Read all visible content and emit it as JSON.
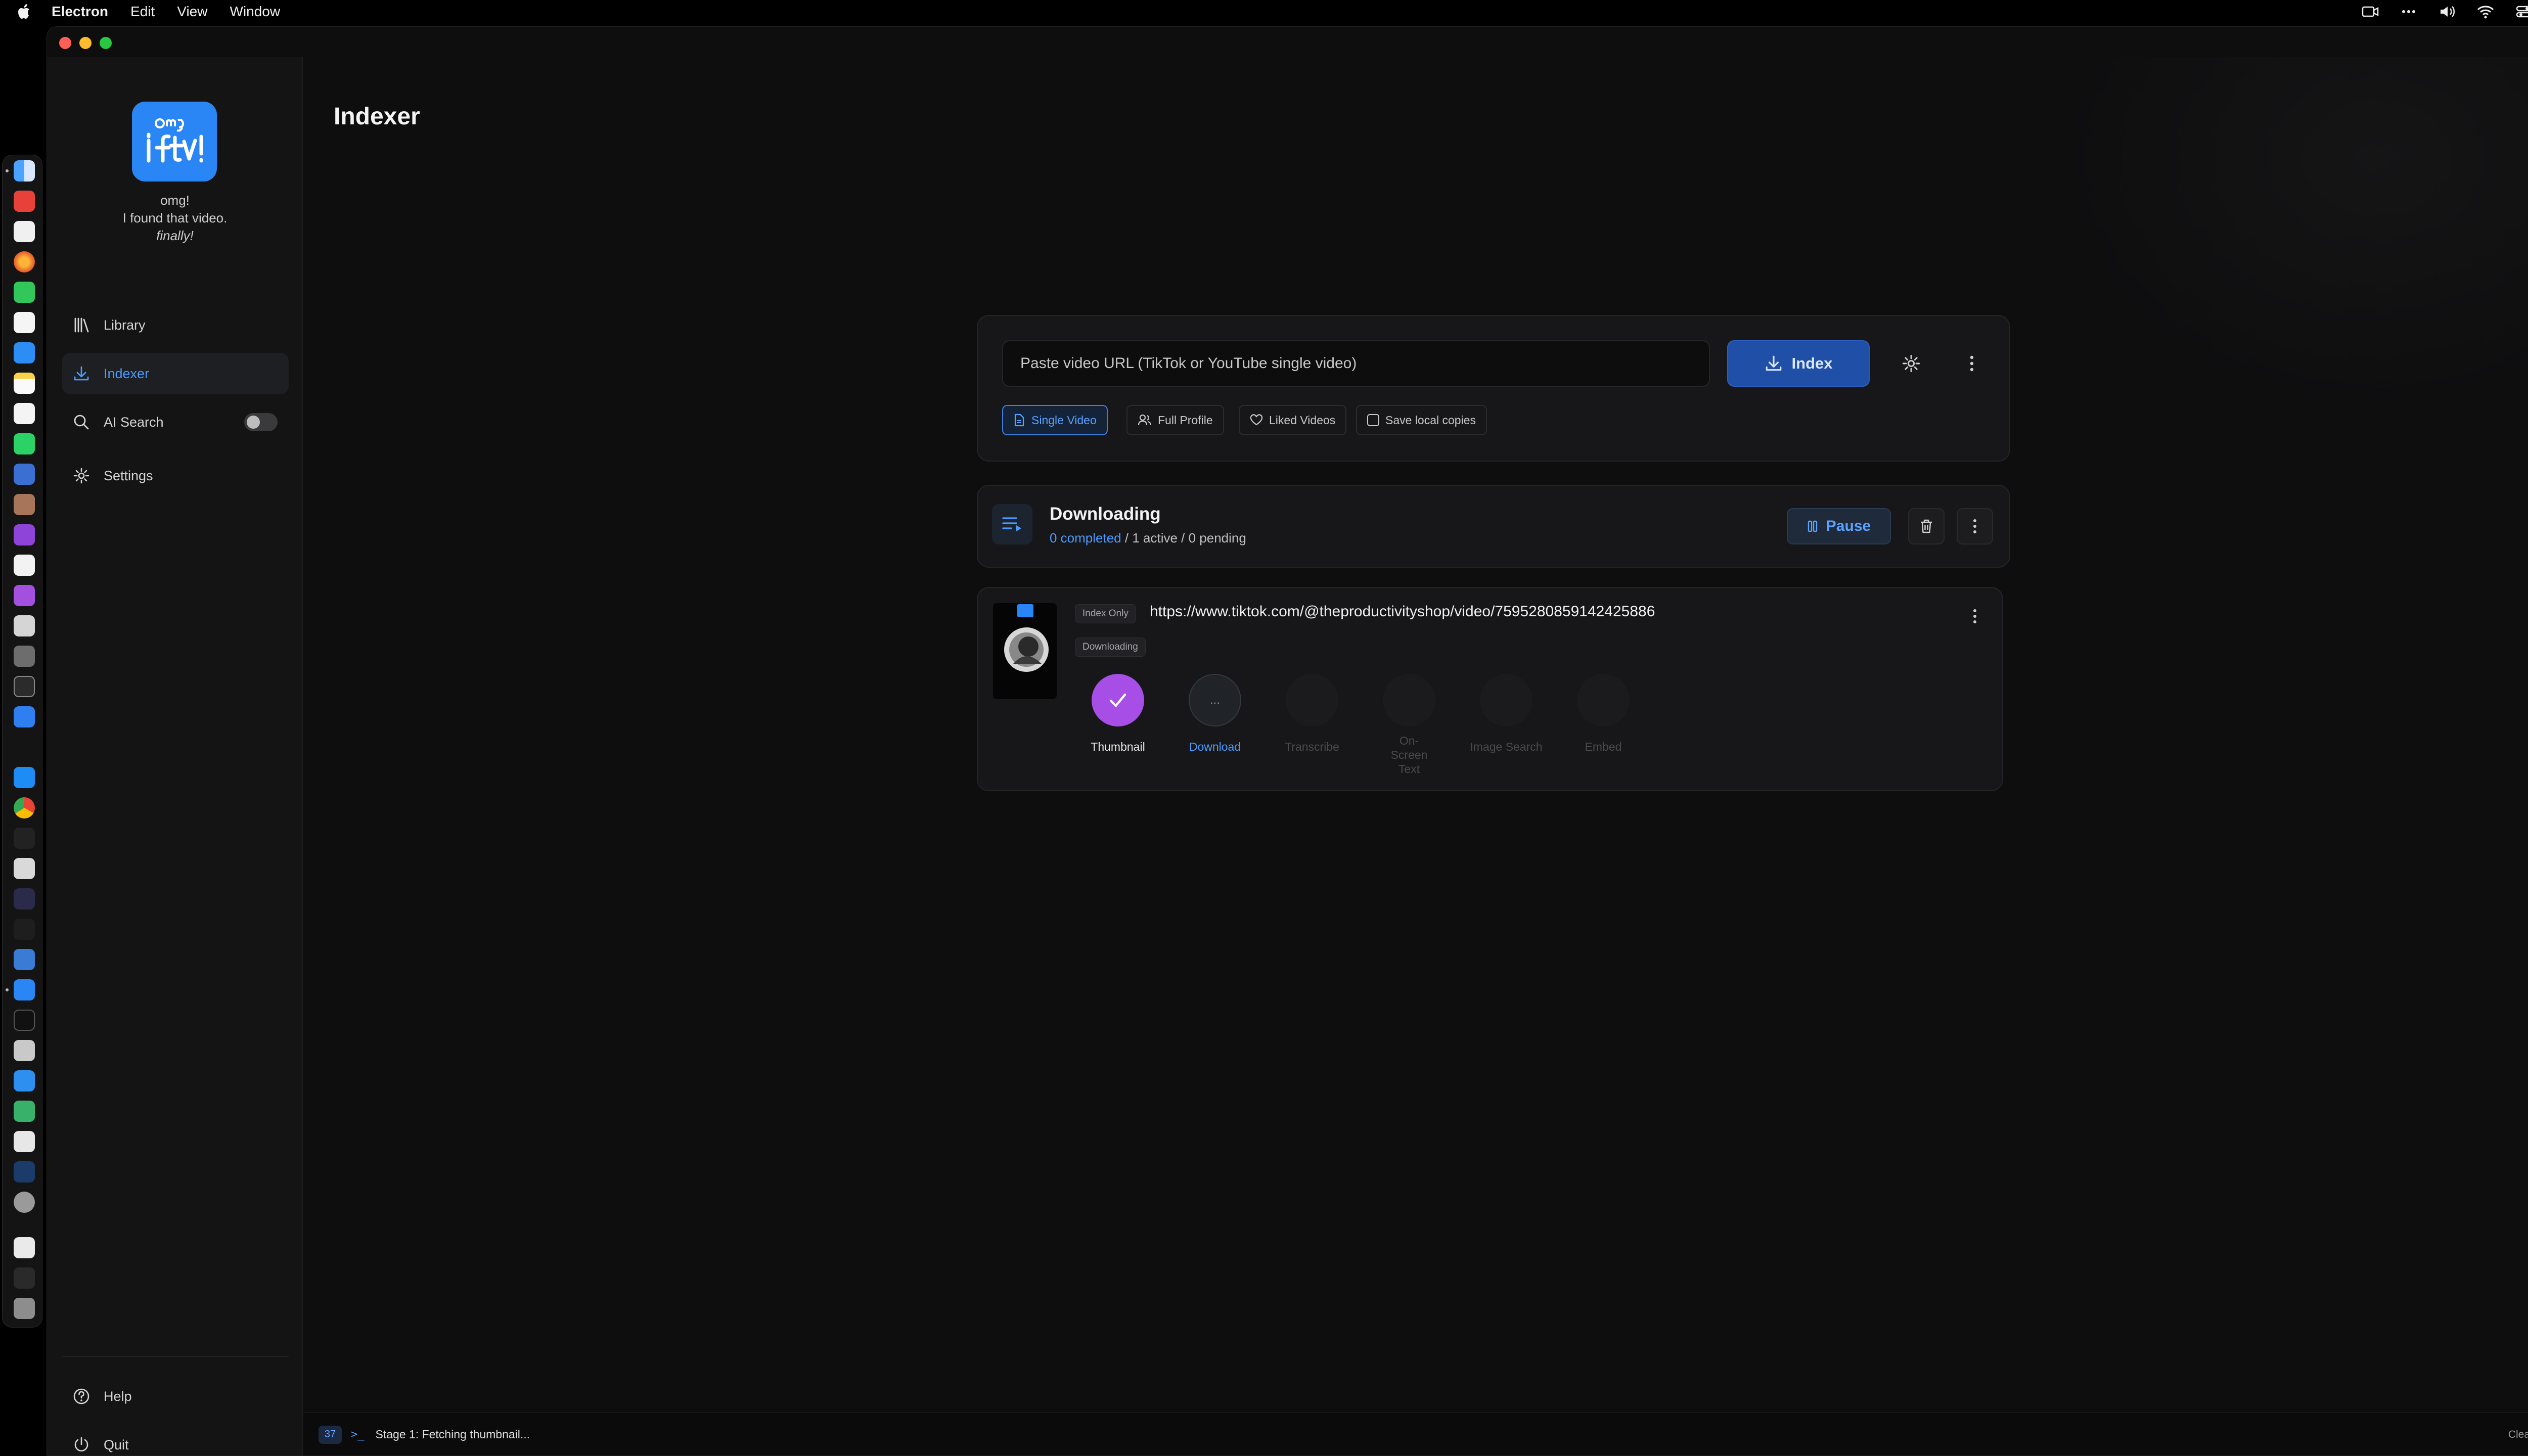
{
  "menubar": {
    "app": "Electron",
    "items": [
      "Edit",
      "View",
      "Window"
    ]
  },
  "sidebar": {
    "tagline_1": "omg!",
    "tagline_2": "I found that video.",
    "tagline_3": "finally!",
    "nav": [
      {
        "label": "Library",
        "icon": "library-icon"
      },
      {
        "label": "Indexer",
        "icon": "download-icon",
        "active": true
      },
      {
        "label": "AI Search",
        "icon": "search-icon",
        "toggle": false
      },
      {
        "label": "Settings",
        "icon": "gear-icon"
      }
    ],
    "help": "Help",
    "quit": "Quit"
  },
  "main": {
    "title": "Indexer",
    "input": {
      "placeholder": "Paste video URL (TikTok or YouTube single video)",
      "value": ""
    },
    "index_button": "Index",
    "modes": [
      {
        "label": "Single Video",
        "selected": true,
        "icon": "document-icon"
      },
      {
        "label": "Full Profile",
        "selected": false,
        "icon": "users-icon"
      },
      {
        "label": "Liked Videos",
        "selected": false,
        "icon": "heart-icon"
      }
    ],
    "save_local": {
      "label": "Save local copies",
      "checked": false
    },
    "queue": {
      "title": "Downloading",
      "completed": "0 completed",
      "rest": " / 1 active / 0 pending",
      "pause": "Pause"
    },
    "job": {
      "tag": "Index Only",
      "url": "https://www.tiktok.com/@theproductivityshop/video/7595280859142425886",
      "status": "Downloading",
      "stages": [
        {
          "label": "Thumbnail",
          "state": "done"
        },
        {
          "label": "Download",
          "state": "active",
          "symbol": "..."
        },
        {
          "label": "Transcribe",
          "state": "pending"
        },
        {
          "label": "On-Screen Text",
          "state": "pending"
        },
        {
          "label": "Image Search",
          "state": "pending"
        },
        {
          "label": "Embed",
          "state": "pending"
        }
      ]
    }
  },
  "status_bar": {
    "count": "37",
    "prompt": ">_",
    "message": "Stage 1: Fetching thumbnail...",
    "clear": "Clear"
  },
  "colors": {
    "accent": "#4a9bff",
    "done": "#a64ee6",
    "logo": "#2a86f5"
  }
}
